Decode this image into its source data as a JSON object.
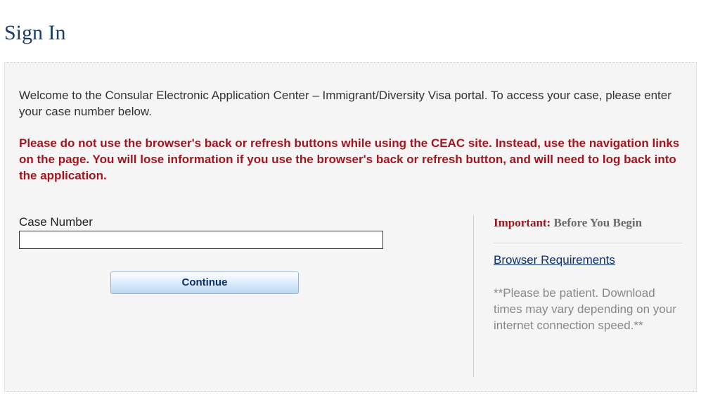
{
  "page": {
    "title": "Sign In"
  },
  "main": {
    "welcome": "Welcome to the Consular Electronic Application Center – Immigrant/Diversity Visa portal. To access your case, please enter your case number below.",
    "warning": "Please do not use the browser's back or refresh buttons while using the CEAC site. Instead, use the navigation links on the page. You will lose information if you use the browser's back or refresh button, and will need to log back into the application."
  },
  "form": {
    "case_label": "Case Number",
    "case_value": "",
    "continue_label": "Continue"
  },
  "sidebar": {
    "important_label": "Important: ",
    "important_title": "Before You Begin",
    "browser_req_label": "Browser Requirements",
    "patience_text": "**Please be patient. Download times may vary depending on your internet connection speed.**"
  }
}
